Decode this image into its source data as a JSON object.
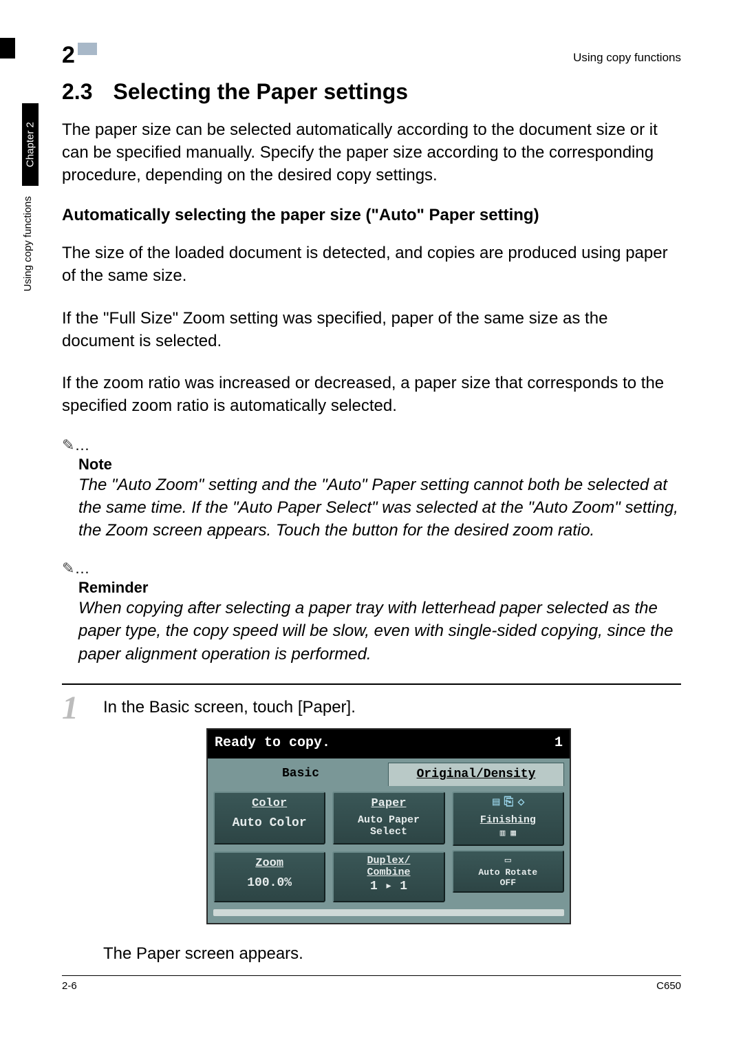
{
  "running_header": "Using copy functions",
  "chapter_tab": "Chapter 2",
  "side_running": "Using copy functions",
  "chapter_number": "2",
  "section": {
    "number": "2.3",
    "title": "Selecting the Paper settings"
  },
  "intro": "The paper size can be selected automatically according to the document size or it can be specified manually. Specify the paper size according to the corresponding procedure, depending on the desired copy settings.",
  "subheading": "Automatically selecting the paper size (\"Auto\" Paper setting)",
  "para1": "The size of the loaded document is detected, and copies are produced using paper of the same size.",
  "para2": "If the \"Full Size\" Zoom setting was specified, paper of the same size as the document is selected.",
  "para3": "If the zoom ratio was increased or decreased, a paper size that corresponds to the specified zoom ratio is automatically selected.",
  "note": {
    "icon": "✎",
    "dots": "…",
    "label": "Note",
    "body": "The \"Auto Zoom\" setting and the \"Auto\" Paper setting cannot both be selected at the same time. If the \"Auto Paper Select\" was selected at the \"Auto Zoom\" setting, the Zoom screen appears. Touch the button for the desired zoom ratio."
  },
  "reminder": {
    "icon": "✎",
    "dots": "…",
    "label": "Reminder",
    "body": "When copying after selecting a paper tray with letterhead paper selected as the paper type, the copy speed will be slow, even with single-sided copying, since the paper alignment operation is performed."
  },
  "step1": {
    "number": "1",
    "text": "In the Basic screen, touch [Paper].",
    "after": "The Paper screen appears."
  },
  "ui": {
    "status": "Ready to copy.",
    "copies": "1",
    "tabs": {
      "basic": "Basic",
      "original_density": "Original/Density"
    },
    "buttons": {
      "color": {
        "title": "Color",
        "value": "Auto Color"
      },
      "paper": {
        "title": "Paper",
        "value_l1": "Auto Paper",
        "value_l2": "Select"
      },
      "zoom": {
        "title": "Zoom",
        "value": "100.0%"
      },
      "duplex": {
        "title_l1": "Duplex/",
        "title_l2": "Combine",
        "value": "1 ▸ 1"
      },
      "finishing": {
        "label": "Finishing"
      },
      "autorotate": {
        "l1": "Auto Rotate",
        "l2": "OFF"
      }
    }
  },
  "footer": {
    "left": "2-6",
    "right": "C650"
  }
}
